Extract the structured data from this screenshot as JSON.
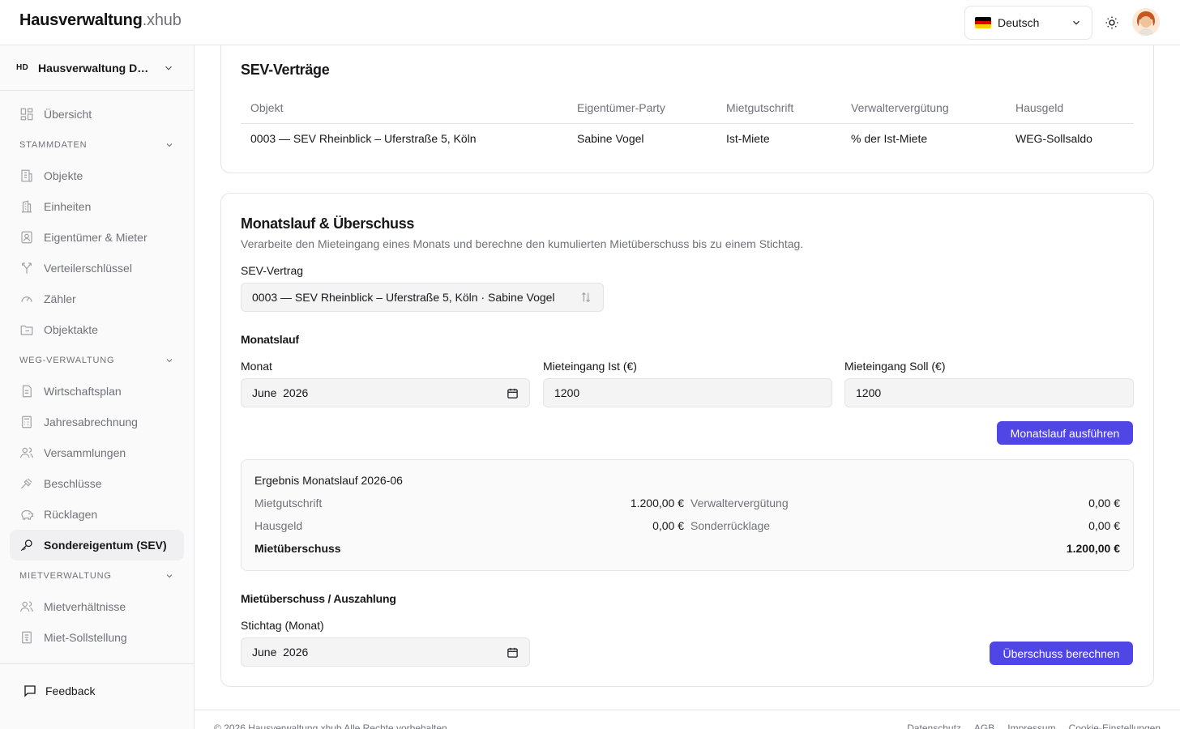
{
  "brand": {
    "name_bold": "Hausverwaltung",
    "name_suffix": ".xhub"
  },
  "header": {
    "language": "Deutsch"
  },
  "sidebar": {
    "org_abbr": "HD",
    "org_name": "Hausverwaltung Dubois",
    "overview": "Übersicht",
    "sections": [
      {
        "title": "STAMMDATEN",
        "items": [
          "Objekte",
          "Einheiten",
          "Eigentümer & Mieter",
          "Verteilerschlüssel",
          "Zähler",
          "Objektakte"
        ]
      },
      {
        "title": "WEG-VERWALTUNG",
        "items": [
          "Wirtschaftsplan",
          "Jahresabrechnung",
          "Versammlungen",
          "Beschlüsse",
          "Rücklagen",
          "Sondereigentum (SEV)"
        ]
      },
      {
        "title": "MIETVERWALTUNG",
        "items": [
          "Mietverhältnisse",
          "Miet-Sollstellung"
        ]
      }
    ],
    "feedback": "Feedback"
  },
  "sev_contracts": {
    "title": "SEV-Verträge",
    "columns": [
      "Objekt",
      "Eigentümer-Party",
      "Mietgutschrift",
      "Verwaltervergütung",
      "Hausgeld"
    ],
    "rows": [
      [
        "0003 — SEV Rheinblick – Uferstraße 5, Köln",
        "Sabine Vogel",
        "Ist-Miete",
        "% der Ist-Miete",
        "WEG-Sollsaldo"
      ]
    ]
  },
  "monthly": {
    "title": "Monatslauf & Überschuss",
    "description": "Verarbeite den Mieteingang eines Monats und berechne den kumulierten Mietüberschuss bis zu einem Stichtag.",
    "contract_label": "SEV-Vertrag",
    "contract_value": "0003 — SEV Rheinblick – Uferstraße 5, Köln · Sabine Vogel",
    "run_heading": "Monatslauf",
    "month_label": "Monat",
    "month_value": "June  2026",
    "rent_actual_label": "Mieteingang Ist (€)",
    "rent_actual_value": "1200",
    "rent_target_label": "Mieteingang Soll (€)",
    "rent_target_value": "1200",
    "run_button": "Monatslauf ausführen",
    "result": {
      "title": "Ergebnis Monatslauf 2026-06",
      "mietgutschrift_label": "Mietgutschrift",
      "mietgutschrift_value": "1.200,00 €",
      "verwalter_label": "Verwaltervergütung",
      "verwalter_value": "0,00 €",
      "hausgeld_label": "Hausgeld",
      "hausgeld_value": "0,00 €",
      "sonder_label": "Sonderrücklage",
      "sonder_value": "0,00 €",
      "ueberschuss_label": "Mietüberschuss",
      "ueberschuss_value": "1.200,00 €"
    },
    "payout_heading": "Mietüberschuss / Auszahlung",
    "cutoff_label": "Stichtag (Monat)",
    "cutoff_value": "June  2026",
    "calc_button": "Überschuss berechnen"
  },
  "footer": {
    "copyright": "© 2026 Hausverwaltung.xhub Alle Rechte vorbehalten.",
    "links": [
      "Datenschutz",
      "AGB",
      "Impressum",
      "Cookie-Einstellungen"
    ]
  }
}
